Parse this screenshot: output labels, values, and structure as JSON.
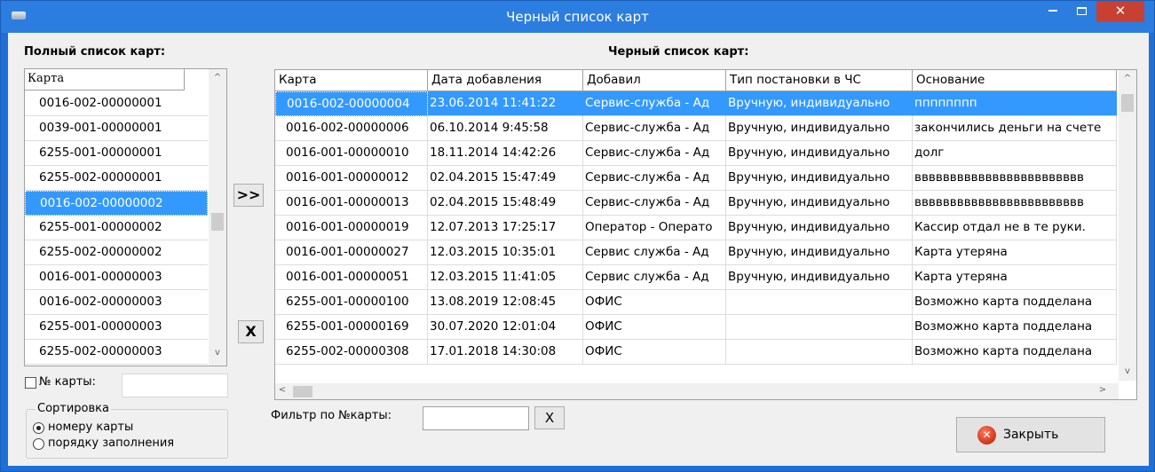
{
  "window": {
    "title": "Черный список карт",
    "minimize": "–",
    "maximize": "□",
    "close": "✕"
  },
  "left_panel": {
    "title": "Полный список карт:",
    "column": "Карта",
    "cards": [
      "0016-002-00000001",
      "0039-001-00000001",
      "6255-001-00000001",
      "6255-002-00000001",
      "0016-002-00000002",
      "6255-001-00000002",
      "6255-002-00000002",
      "0016-001-00000003",
      "0016-002-00000003",
      "6255-001-00000003",
      "6255-002-00000003"
    ],
    "selected_index": 4,
    "card_number_label": "№ карты:",
    "card_number_value": "",
    "sort": {
      "title": "Сортировка",
      "options": [
        "номеру карты",
        "порядку заполнения"
      ],
      "selected": "номеру карты"
    }
  },
  "buttons": {
    "add": ">>",
    "remove": "X",
    "filter_clear": "X",
    "close": "Закрыть"
  },
  "blacklist": {
    "title": "Черный список карт:",
    "columns": [
      "Карта",
      "Дата добавления",
      "Добавил",
      "Тип постановки в ЧС",
      "Основание"
    ],
    "rows": [
      [
        "0016-002-00000004",
        "23.06.2014 11:41:22",
        "Сервис-служба - Ад",
        "Вручную, индивидуально",
        "пппппппп"
      ],
      [
        "0016-002-00000006",
        "06.10.2014 9:45:58",
        "Сервис-служба - Ад",
        "Вручную, индивидуально",
        "закончились деньги на счете"
      ],
      [
        "0016-001-00000010",
        "18.11.2014 14:42:26",
        "Сервис-служба - Ад",
        "Вручную, индивидуально",
        "долг"
      ],
      [
        "0016-001-00000012",
        "02.04.2015 15:47:49",
        "Сервис-служба - Ад",
        "Вручную, индивидуально",
        "вввввввввввввввввввввввв"
      ],
      [
        "0016-001-00000013",
        "02.04.2015 15:48:49",
        "Сервис-служба - Ад",
        "Вручную, индивидуально",
        "вввввввввввввввввввввввв"
      ],
      [
        "0016-001-00000019",
        "12.07.2013 17:25:17",
        "Оператор - Операто",
        "Вручную, индивидуально",
        "Кассир отдал не в те руки."
      ],
      [
        "0016-001-00000027",
        "12.03.2015 10:35:01",
        "Сервис служба - Ад",
        "Вручную, индивидуально",
        "Карта утеряна"
      ],
      [
        "0016-001-00000051",
        "12.03.2015 11:41:05",
        "Сервис служба - Ад",
        "Вручную, индивидуально",
        "Карта утеряна"
      ],
      [
        "6255-001-00000100",
        "13.08.2019 12:08:45",
        "ОФИС",
        "",
        "Возможно карта подделана"
      ],
      [
        "6255-001-00000169",
        "30.07.2020 12:01:04",
        "ОФИС",
        "",
        "Возможно карта подделана"
      ],
      [
        "6255-002-00000308",
        "17.01.2018 14:30:08",
        "ОФИС",
        "",
        "Возможно карта подделана"
      ]
    ],
    "selected_index": 0,
    "filter_label": "Фильтр по №карты:",
    "filter_value": ""
  },
  "icons": {
    "up": "^",
    "down": "v",
    "left": "<",
    "right": ">"
  },
  "colors": {
    "title_bar": "#2b7de0",
    "selection": "#3399ff",
    "close_button": "#c84031"
  }
}
